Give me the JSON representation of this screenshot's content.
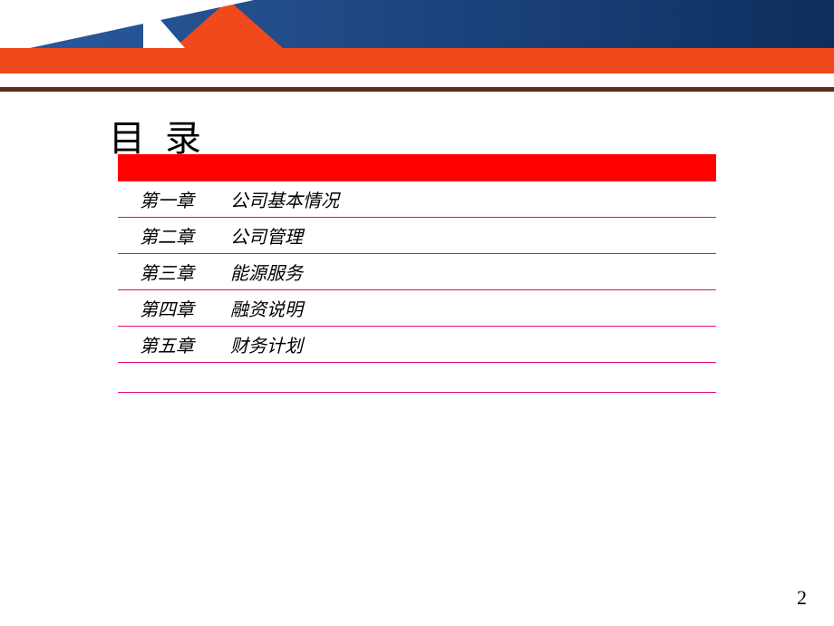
{
  "title": "目 录",
  "toc": [
    {
      "chapter": "第一章",
      "desc": "公司基本情况"
    },
    {
      "chapter": "第二章",
      "desc": "公司管理"
    },
    {
      "chapter": "第三章",
      "desc": "能源服务"
    },
    {
      "chapter": "第四章",
      "desc": "融资说明"
    },
    {
      "chapter": "第五章",
      "desc": "财务计划"
    }
  ],
  "pageNumber": "2",
  "colors": {
    "blueGradientStart": "#2a5a9e",
    "blueGradientEnd": "#0d2f5e",
    "orange": "#f04a1c",
    "brownRule": "#5a2e1a",
    "redBar": "#ff0000",
    "magentaLine": "#e30d7a"
  }
}
